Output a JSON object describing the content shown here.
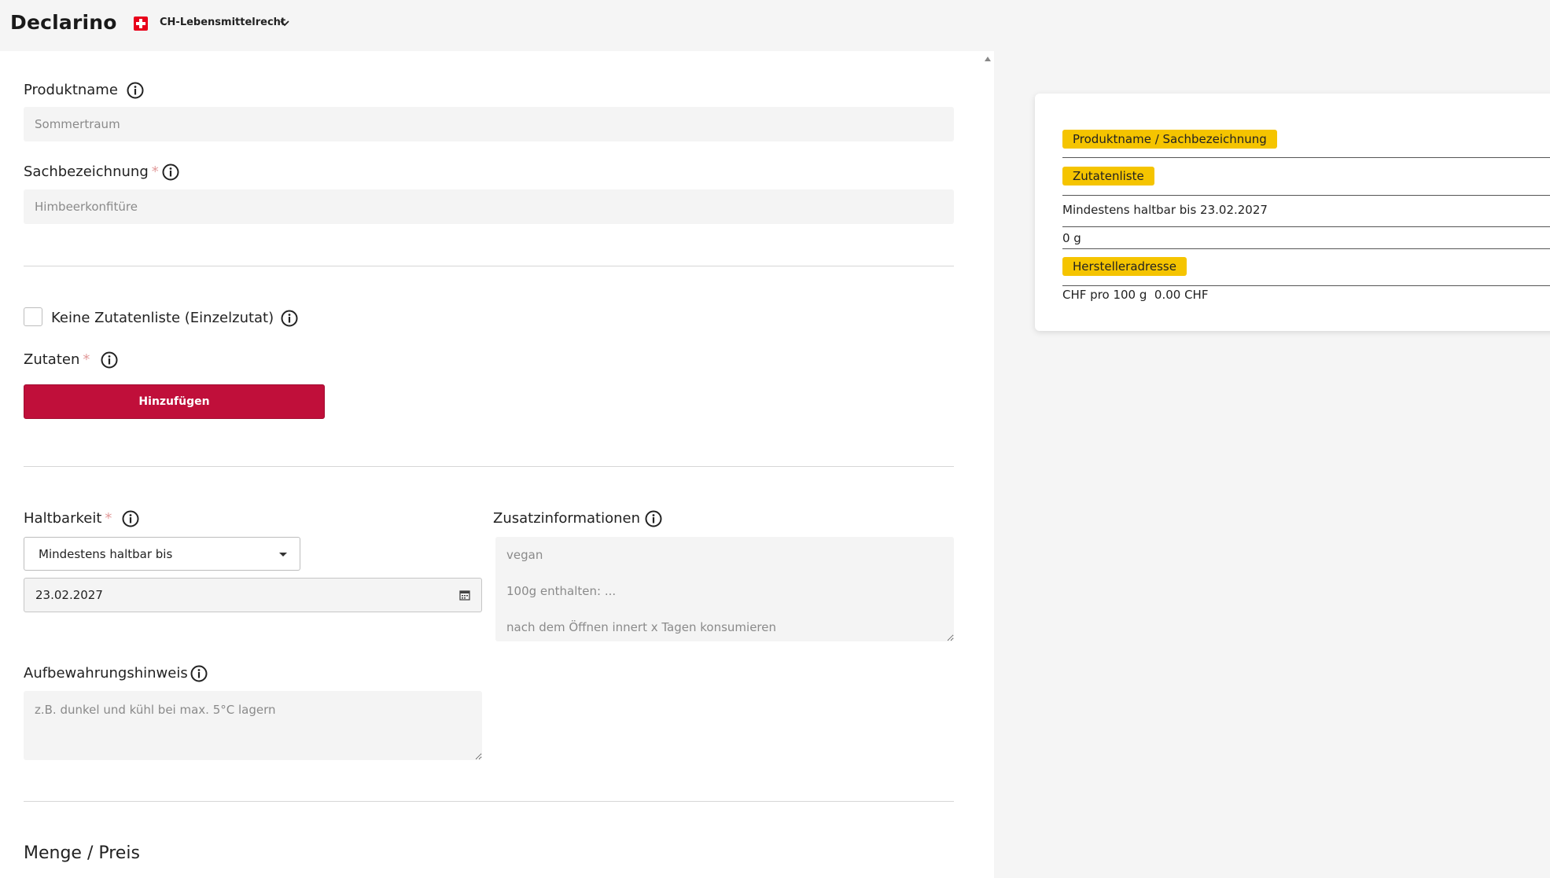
{
  "header": {
    "logo": "Declarino",
    "region": "CH-Lebensmittelrecht"
  },
  "form": {
    "produktname": {
      "label": "Produktname",
      "placeholder": "Sommertraum"
    },
    "sachbezeichnung": {
      "label": "Sachbezeichnung",
      "required": "*",
      "placeholder": "Himbeerkonfitüre"
    },
    "keine_zutatenliste": {
      "label": "Keine Zutatenliste (Einzelzutat)"
    },
    "zutaten": {
      "label": "Zutaten",
      "required": "*",
      "add_button": "Hinzufügen"
    },
    "haltbarkeit": {
      "label": "Haltbarkeit",
      "required": "*",
      "selected": "Mindestens haltbar bis",
      "date": "23.02.2027"
    },
    "zusatzinformationen": {
      "label": "Zusatzinformationen",
      "placeholder": "vegan\n100g enthalten: ...\nnach dem Öffnen innert x Tagen konsumieren"
    },
    "aufbewahrungshinweis": {
      "label": "Aufbewahrungshinweis",
      "placeholder": "z.B. dunkel und kühl bei max. 5°C lagern"
    },
    "menge_preis": {
      "title": "Menge / Preis"
    }
  },
  "preview": {
    "badge_name": "Produktname / Sachbezeichnung",
    "badge_zutaten": "Zutatenliste",
    "haltbar": "Mindestens haltbar bis 23.02.2027",
    "menge": "0 g",
    "badge_hersteller": "Herstelleradresse",
    "preis": "CHF pro 100 g  0.00 CHF"
  },
  "colors": {
    "accent": "#c00f3a",
    "badge": "#f5c400",
    "flag": "#e8001a"
  }
}
